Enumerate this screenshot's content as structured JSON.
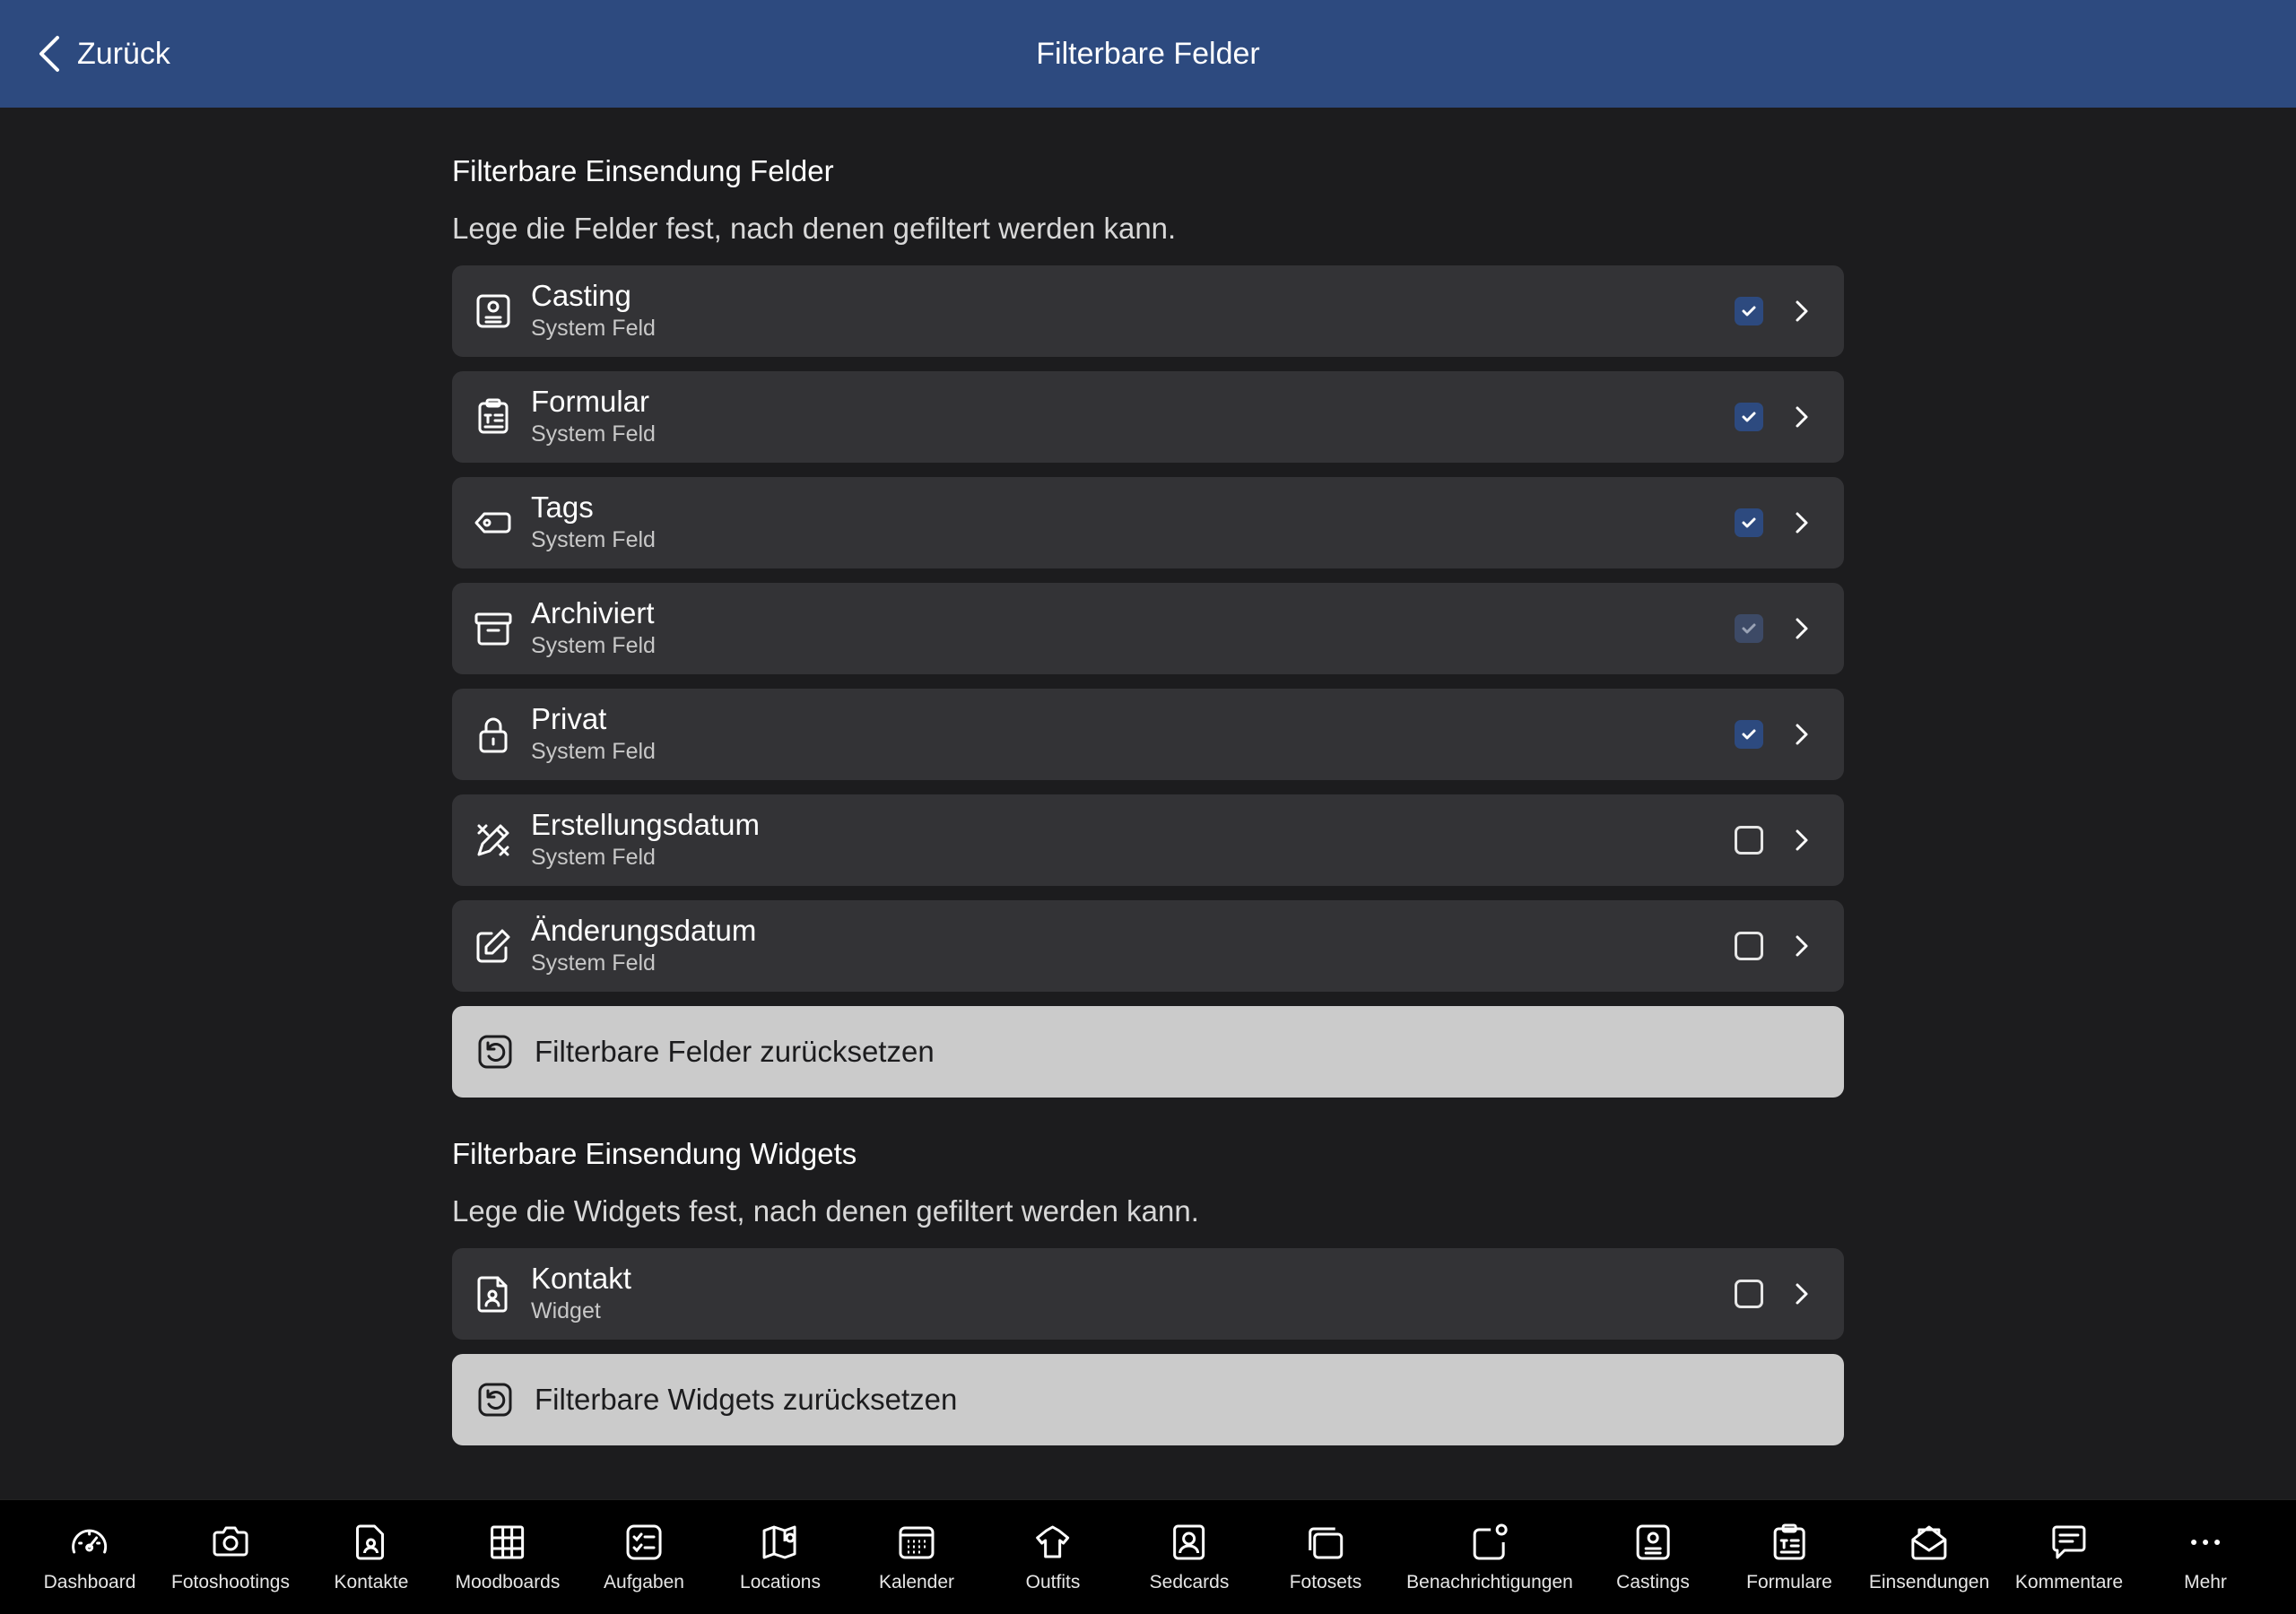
{
  "header": {
    "back_label": "Zurück",
    "title": "Filterbare Felder"
  },
  "fields_section": {
    "title": "Filterbare Einsendung Felder",
    "description": "Lege die Felder fest, nach denen gefiltert werden kann.",
    "items": [
      {
        "title": "Casting",
        "subtitle": "System Feld",
        "icon": "casting-icon",
        "checked": true
      },
      {
        "title": "Formular",
        "subtitle": "System Feld",
        "icon": "clipboard-icon",
        "checked": true
      },
      {
        "title": "Tags",
        "subtitle": "System Feld",
        "icon": "tag-icon",
        "checked": true
      },
      {
        "title": "Archiviert",
        "subtitle": "System Feld",
        "icon": "archive-icon",
        "checked": true,
        "disabled": true
      },
      {
        "title": "Privat",
        "subtitle": "System Feld",
        "icon": "lock-icon",
        "checked": true
      },
      {
        "title": "Erstellungsdatum",
        "subtitle": "System Feld",
        "icon": "pencil-ruler-icon",
        "checked": false
      },
      {
        "title": "Änderungsdatum",
        "subtitle": "System Feld",
        "icon": "edit-icon",
        "checked": false
      }
    ],
    "reset_label": "Filterbare Felder zurücksetzen"
  },
  "widgets_section": {
    "title": "Filterbare Einsendung Widgets",
    "description": "Lege die Widgets fest, nach denen gefiltert werden kann.",
    "items": [
      {
        "title": "Kontakt",
        "subtitle": "Widget",
        "icon": "contact-file-icon",
        "checked": false
      }
    ],
    "reset_label": "Filterbare Widgets zurücksetzen"
  },
  "tabbar": {
    "items": [
      {
        "label": "Dashboard",
        "icon": "speedometer-icon"
      },
      {
        "label": "Fotoshootings",
        "icon": "camera-icon"
      },
      {
        "label": "Kontakte",
        "icon": "contact-file-icon"
      },
      {
        "label": "Moodboards",
        "icon": "grid-icon"
      },
      {
        "label": "Aufgaben",
        "icon": "checklist-icon"
      },
      {
        "label": "Locations",
        "icon": "map-icon"
      },
      {
        "label": "Kalender",
        "icon": "calendar-icon"
      },
      {
        "label": "Outfits",
        "icon": "hanger-icon"
      },
      {
        "label": "Sedcards",
        "icon": "portrait-icon"
      },
      {
        "label": "Fotosets",
        "icon": "photos-icon"
      },
      {
        "label": "Benachrichtigungen",
        "icon": "notification-icon"
      },
      {
        "label": "Castings",
        "icon": "casting-icon"
      },
      {
        "label": "Formulare",
        "icon": "clipboard-icon"
      },
      {
        "label": "Einsendungen",
        "icon": "envelope-open-icon"
      },
      {
        "label": "Kommentare",
        "icon": "comment-icon"
      },
      {
        "label": "Mehr",
        "icon": "more-icon"
      }
    ]
  }
}
